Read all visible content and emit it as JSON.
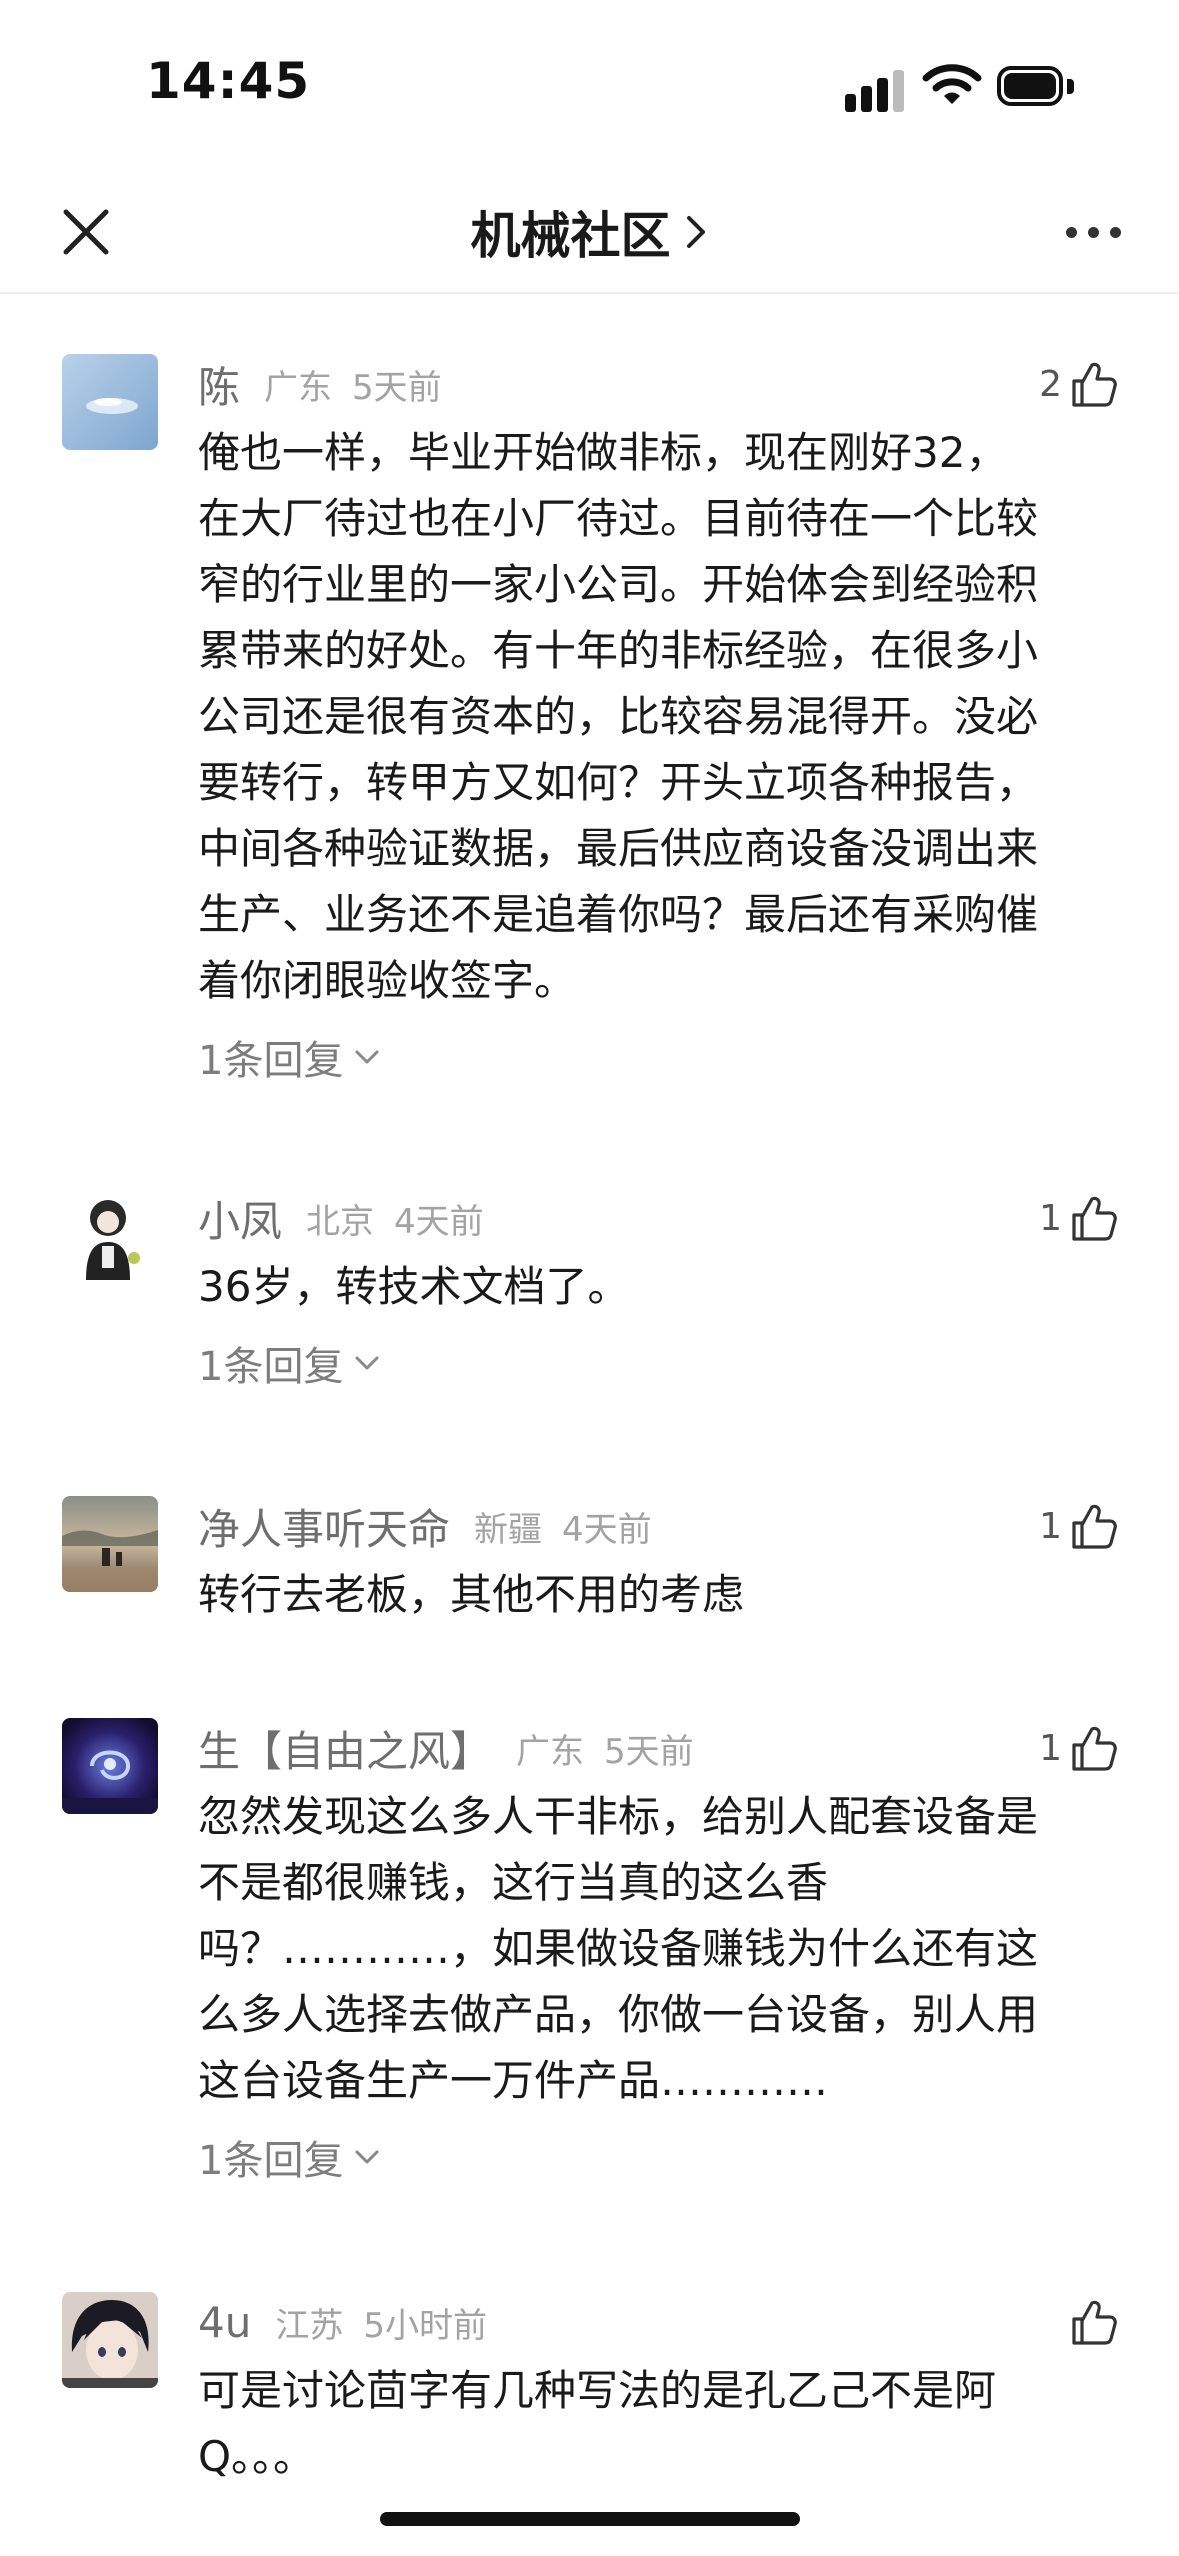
{
  "status_bar": {
    "time": "14:45"
  },
  "nav": {
    "title": "机械社区"
  },
  "comments": [
    {
      "username": "陈",
      "region": "广东",
      "time_ago": "5天前",
      "likes": "2",
      "text": "俺也一样，毕业开始做非标，现在刚好32，\n在大厂待过也在小厂待过。目前待在一个比较\n窄的行业里的一家小公司。开始体会到经验积\n累带来的好处。有十年的非标经验，在很多小\n公司还是很有资本的，比较容易混得开。没必\n要转行，转甲方又如何？开头立项各种报告，\n中间各种验证数据，最后供应商设备没调出来\n生产、业务还不是追着你吗？最后还有采购催\n着你闭眼验收签字。",
      "replies": "1条回复"
    },
    {
      "username": "小凤",
      "region": "北京",
      "time_ago": "4天前",
      "likes": "1",
      "text": "36岁，转技术文档了。",
      "replies": "1条回复"
    },
    {
      "username": "净人事听天命",
      "region": "新疆",
      "time_ago": "4天前",
      "likes": "1",
      "text": "转行去老板，其他不用的考虑"
    },
    {
      "username": "生【自由之风】",
      "region": "广东",
      "time_ago": "5天前",
      "likes": "1",
      "text": "忽然发现这么多人干非标，给别人配套设备是\n不是都很赚钱，这行当真的这么香\n吗？…………，如果做设备赚钱为什么还有这\n么多人选择去做产品，你做一台设备，别人用\n这台设备生产一万件产品…………",
      "replies": "1条回复"
    },
    {
      "username": "4u",
      "region": "江苏",
      "time_ago": "5小时前",
      "likes": "",
      "text": "可是讨论茴字有几种写法的是孔乙己不是阿\nQ。。。"
    }
  ],
  "colors": {
    "text_primary": "#1a1a1a",
    "text_secondary": "#6e6e6e",
    "text_muted": "#a3a3a3"
  },
  "icons": [
    "close-icon",
    "chevron-right-icon",
    "more-icon",
    "thumbs-up-icon",
    "chevron-down-icon",
    "signal-icon",
    "wifi-icon",
    "battery-icon"
  ]
}
